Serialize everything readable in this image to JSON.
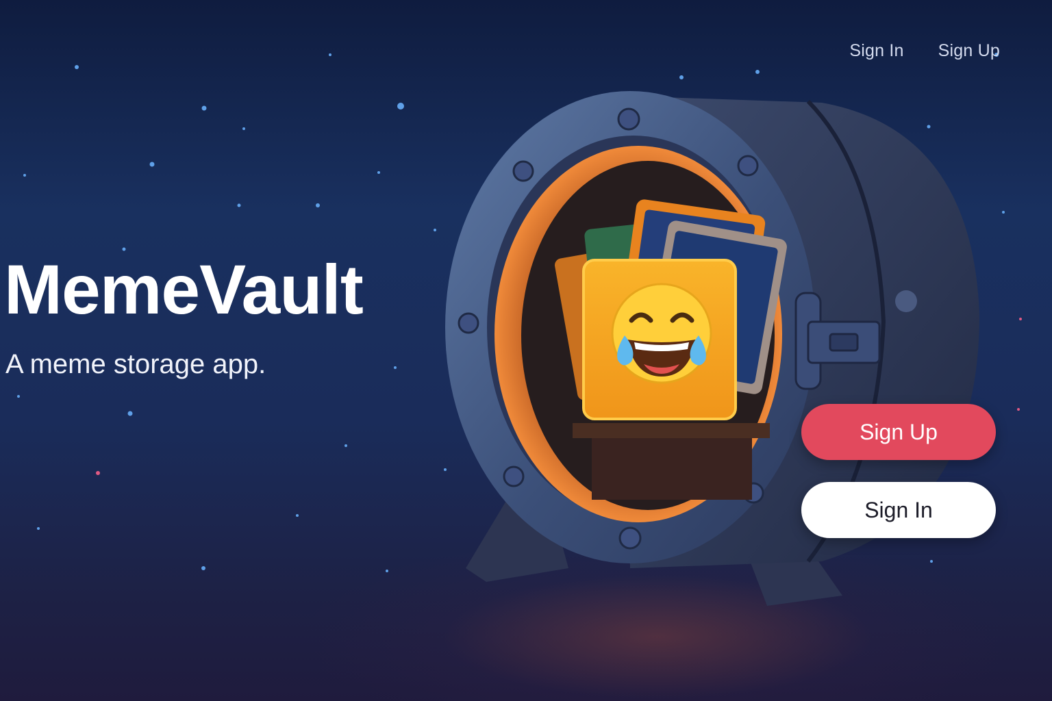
{
  "nav": {
    "signin_label": "Sign In",
    "signup_label": "Sign Up"
  },
  "hero": {
    "title": "MemeVault",
    "subtitle": "A meme storage app."
  },
  "cta": {
    "signup_label": "Sign Up",
    "signin_label": "Sign In"
  },
  "illustration": {
    "vault_icon": "vault-icon",
    "emoji_icon": "tears-of-joy-emoji-icon"
  },
  "colors": {
    "accent": "#e2495d",
    "background": "#19305f",
    "vault_glow": "#f07a2a",
    "meme_card": "#f6a821"
  }
}
